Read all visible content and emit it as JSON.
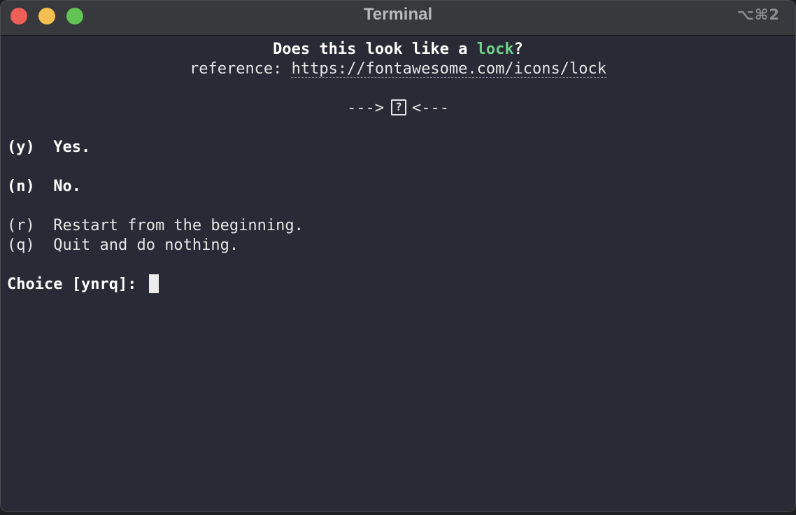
{
  "window": {
    "title": "Terminal",
    "shortcut": "⌥⌘2"
  },
  "colors": {
    "background": "#282a35",
    "titlebar": "#38393d",
    "accent_green": "#6ed28b",
    "text": "#e6e6e6"
  },
  "prompt": {
    "question_prefix": "Does this look like a ",
    "icon_name": "lock",
    "question_suffix": "?",
    "reference_label": "reference: ",
    "reference_url": "https://fontawesome.com/icons/lock",
    "arrow_left": "--->",
    "glyph": "?",
    "arrow_right": "<---"
  },
  "options": [
    {
      "key": "(y)",
      "label": "Yes."
    },
    {
      "key": "(n)",
      "label": "No."
    },
    {
      "key": "(r)",
      "label": "Restart from the beginning."
    },
    {
      "key": "(q)",
      "label": "Quit and do nothing."
    }
  ],
  "input": {
    "label": "Choice [ynrq]: ",
    "value": ""
  }
}
